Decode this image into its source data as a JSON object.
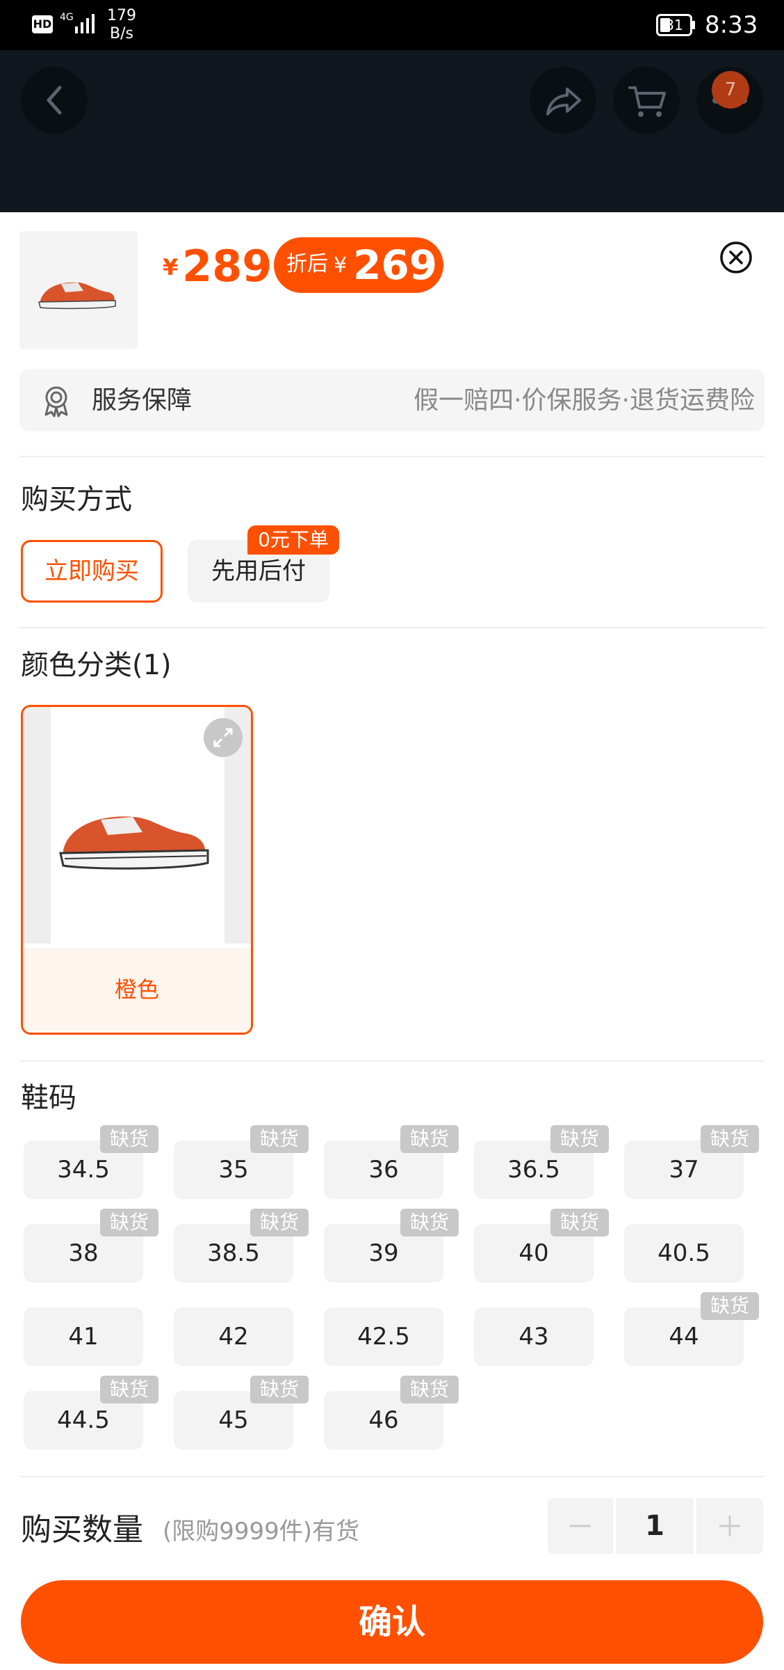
{
  "status_bar": {
    "hd": "HD",
    "network": "4G",
    "speed_value": "179",
    "speed_unit": "B/s",
    "battery": "31",
    "time": "8:33"
  },
  "top_bar": {
    "cart_badge": "7",
    "icons": [
      "back-icon",
      "share-icon",
      "cart-icon",
      "more-icon"
    ]
  },
  "price": {
    "currency": "¥",
    "main": "289",
    "discount_label": "折后",
    "discount_currency": "¥",
    "discount": "269"
  },
  "service": {
    "title": "服务保障",
    "items": "假一赔四·价保服务·退货运费险"
  },
  "purchase_method": {
    "title": "购买方式",
    "options": [
      {
        "label": "立即购买",
        "selected": true
      },
      {
        "label": "先用后付",
        "selected": false,
        "tag": "0元下单"
      }
    ]
  },
  "color": {
    "title": "颜色分类(1)",
    "options": [
      {
        "label": "橙色",
        "selected": true
      }
    ]
  },
  "size": {
    "title": "鞋码",
    "out_of_stock_label": "缺货",
    "options": [
      {
        "label": "34.5",
        "out_of_stock": true
      },
      {
        "label": "35",
        "out_of_stock": true
      },
      {
        "label": "36",
        "out_of_stock": true
      },
      {
        "label": "36.5",
        "out_of_stock": true
      },
      {
        "label": "37",
        "out_of_stock": true
      },
      {
        "label": "38",
        "out_of_stock": true
      },
      {
        "label": "38.5",
        "out_of_stock": true
      },
      {
        "label": "39",
        "out_of_stock": true
      },
      {
        "label": "40",
        "out_of_stock": true
      },
      {
        "label": "40.5",
        "out_of_stock": false
      },
      {
        "label": "41",
        "out_of_stock": false
      },
      {
        "label": "42",
        "out_of_stock": false
      },
      {
        "label": "42.5",
        "out_of_stock": false
      },
      {
        "label": "43",
        "out_of_stock": false
      },
      {
        "label": "44",
        "out_of_stock": true
      },
      {
        "label": "44.5",
        "out_of_stock": true
      },
      {
        "label": "45",
        "out_of_stock": true
      },
      {
        "label": "46",
        "out_of_stock": true
      }
    ]
  },
  "quantity": {
    "title": "购买数量",
    "limit": "(限购9999件)有货",
    "value": "1"
  },
  "confirm_label": "确认",
  "colors": {
    "accent": "#ff5000",
    "out_of_stock_tag": "#c8c8c8",
    "option_bg": "#f3f3f3"
  }
}
